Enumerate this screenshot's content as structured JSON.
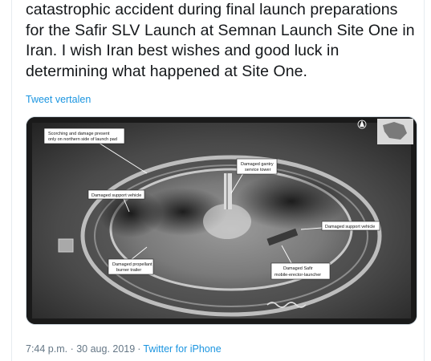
{
  "tweet": {
    "text_lines": [
      "catastrophic accident during final launch preparations",
      "for the Safir SLV Launch at Semnan Launch Site One in",
      "Iran. I wish Iran best wishes and good luck in",
      "determining what happened at Site One."
    ],
    "translate_label": "Tweet vertalen",
    "timestamp": "7:44 p.m. · 30 aug. 2019",
    "separator": "·",
    "source_label": "Twitter for iPhone"
  },
  "image": {
    "annotations": {
      "scorching": [
        "Scorching and damage present",
        "only on northern side of launch pad"
      ],
      "gantry": [
        "Damaged gantry",
        "service tower"
      ],
      "support_left": [
        "Damaged support vehicle"
      ],
      "support_right": [
        "Damaged support vehicle"
      ],
      "propellant": [
        "Damaged propellant",
        "burner trailer"
      ],
      "safir": [
        "Damaged Safir",
        "mobile-erector-launcher"
      ]
    }
  }
}
